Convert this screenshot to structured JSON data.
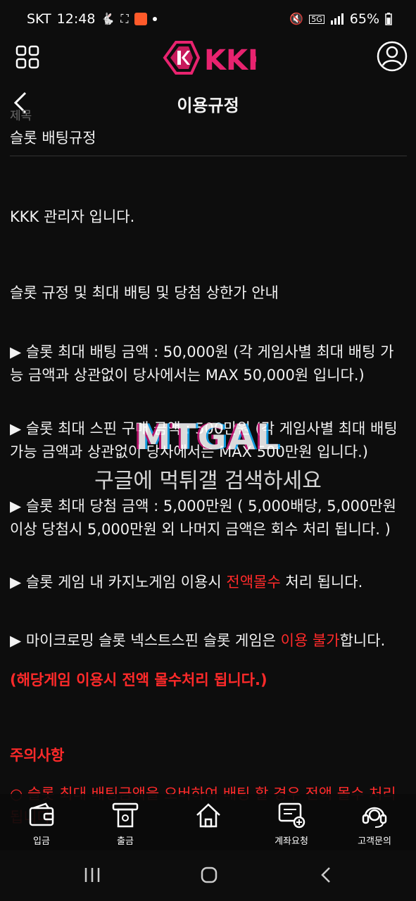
{
  "status_bar": {
    "carrier": "SKT",
    "time": "12:48",
    "network": "5G",
    "battery": "65%"
  },
  "header": {
    "logo_text": "KKK"
  },
  "page": {
    "title": "이용규정",
    "field_label": "제목",
    "post_title": "슬롯 배팅규정"
  },
  "body": {
    "p1": "KKK 관리자 입니다.",
    "p2": "슬롯 규정 및 최대 배팅 및 당첨 상한가 안내",
    "p3": "▶ 슬롯 최대 배팅 금액 : 50,000원 (각 게임사별 최대 배팅 가능 금액과 상관없이 당사에서는 MAX 50,000원 입니다.)",
    "p4": "▶ 슬롯 최대 스핀 구매 금액 : 500만원 (각 게임사별 최대 배팅 가능 금액과 상관없이 당사에서는 MAX 500만원 입니다.)",
    "p5": "▶ 슬롯 최대 당첨 금액 : 5,000만원 ( 5,000배당, 5,000만원 이상 당첨시 5,000만원 외 나머지 금액은 회수 처리 됩니다. )",
    "p6_pre": "▶ 슬롯 게임 내 카지노게임 이용시 ",
    "p6_red": "전액몰수",
    "p6_post": " 처리 됩니다.",
    "p7_pre": "▶ 마이크로밍 슬롯 넥스트스핀 슬롯 게임은 ",
    "p7_red": "이용 불가",
    "p7_post": "합니다.",
    "p8": "(해당게임 이용시 전액 몰수처리 됩니다.)",
    "notice_heading": "주의사항",
    "notice_1": "○ 슬롯 최대 배팅금액을 오버하여 배팅 할 경우 전액 몰수 처리 됩니다."
  },
  "watermark": {
    "logo": "MTGAL",
    "text": "구글에 먹튀갤 검색하세요"
  },
  "bottom_nav": {
    "deposit": "입금",
    "withdraw": "출금",
    "account_request": "계좌요청",
    "support": "고객문의"
  },
  "colors": {
    "background": "#0d0d0d",
    "accent_red": "#ff2a2a",
    "logo_pink": "#e8236f"
  }
}
